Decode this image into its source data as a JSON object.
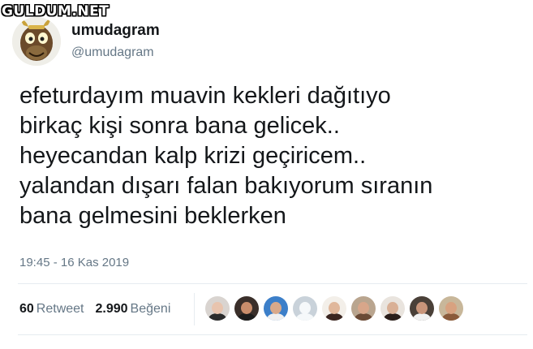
{
  "watermark": "GULDUM.NET",
  "author": {
    "display_name": "umudagram",
    "handle": "@umudagram",
    "avatar_icon": "cartoon-horse-avatar"
  },
  "tweet": {
    "text": "efeturdayım muavin kekleri dağıtıyo\nbirkaç kişi sonra bana gelicek..\nheyecandan kalp krizi geçiricem..\nyalandan dışarı falan bakıyorum sıranın\nbana gelmesini beklerken",
    "timestamp": "19:45 - 16 Kas 2019"
  },
  "stats": {
    "retweet_count": "60",
    "retweet_label": "Retweet",
    "like_count": "2.990",
    "like_label": "Beğeni"
  },
  "liker_avatars": [
    {
      "name": "liker-avatar-1",
      "bg": "#d9d4d0",
      "skin": "#e8c4ae",
      "cloth": "#2b2b2b"
    },
    {
      "name": "liker-avatar-2",
      "bg": "#3a2f2a",
      "skin": "#c98d6b",
      "cloth": "#1c1c1c"
    },
    {
      "name": "liker-avatar-3",
      "bg": "#3c7fc9",
      "skin": "#d9a98a",
      "cloth": "#f0f0f0"
    },
    {
      "name": "liker-avatar-4",
      "bg": "#c9d2da",
      "skin": "#f5f8fa",
      "cloth": "#f5f8fa"
    },
    {
      "name": "liker-avatar-5",
      "bg": "#f3efe9",
      "skin": "#e0b79b",
      "cloth": "#3a2520"
    },
    {
      "name": "liker-avatar-6",
      "bg": "#b9a58f",
      "skin": "#d8a68a",
      "cloth": "#6b4a36"
    },
    {
      "name": "liker-avatar-7",
      "bg": "#e9e4de",
      "skin": "#d9b096",
      "cloth": "#2a1e1a"
    },
    {
      "name": "liker-avatar-8",
      "bg": "#4a4038",
      "skin": "#c9957a",
      "cloth": "#f2f2f2"
    },
    {
      "name": "liker-avatar-9",
      "bg": "#c8b79a",
      "skin": "#d8a280",
      "cloth": "#8a5a3a"
    }
  ]
}
